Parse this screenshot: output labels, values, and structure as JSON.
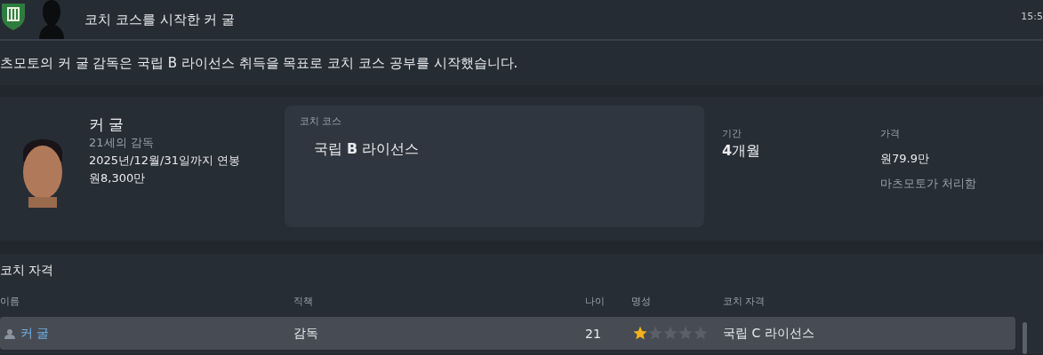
{
  "header": {
    "title": "코치 코스를 시작한 커 굴",
    "time": "15:5"
  },
  "message": "츠모토의 커 굴 감독은 국립 B 라이선스 취득을 목표로 코치 코스 공부를 시작했습니다.",
  "person": {
    "name": "커 굴",
    "role": "21세의 감독",
    "contract": "2025년/12월/31일까지 연봉",
    "salary": "원8,300만"
  },
  "course": {
    "label": "코치 코스",
    "name": "국립 **B** 라이선스"
  },
  "duration": {
    "label": "기간",
    "value": "**4**개월"
  },
  "price": {
    "label": "가격",
    "value": "원79.9만",
    "note": "마츠모토가 처리함"
  },
  "qualifications": {
    "title": "코치 자격",
    "columns": [
      "이름",
      "직책",
      "나이",
      "명성",
      "코치 자격"
    ],
    "rows": [
      {
        "name": "커 굴",
        "role": "감독",
        "age": "21",
        "stars": 1,
        "qualification": "국립 C 라이선스",
        "selected": true
      }
    ]
  }
}
